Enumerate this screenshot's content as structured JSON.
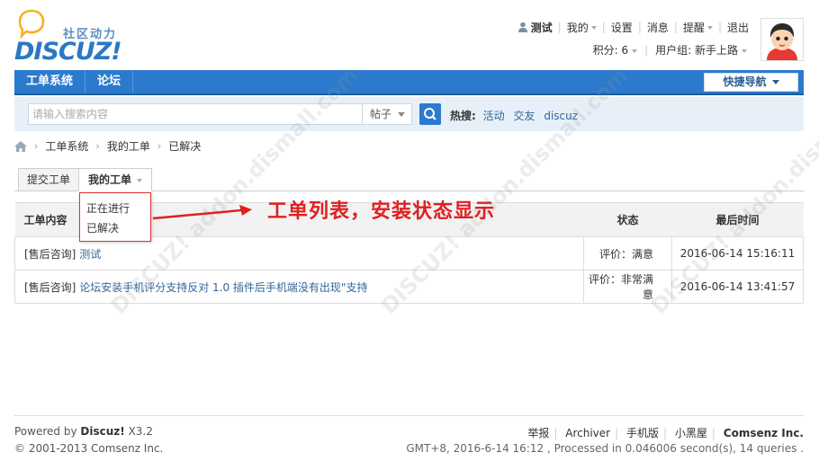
{
  "brand": {
    "cn": "社区动力",
    "en": "DISCUZ!"
  },
  "topnav": {
    "username": "测试",
    "items": [
      "我的",
      "设置",
      "消息",
      "提醒",
      "退出"
    ]
  },
  "userinfo": {
    "points": "积分: 6",
    "group": "用户组: 新手上路"
  },
  "navbar": {
    "items": [
      "工单系统",
      "论坛"
    ],
    "quicknav": "快捷导航"
  },
  "search": {
    "placeholder": "请输入搜索内容",
    "select": "帖子",
    "hot_label": "热搜:",
    "hot_items": [
      "活动",
      "交友",
      "discuz"
    ]
  },
  "breadcrumb": [
    "工单系统",
    "我的工单",
    "已解决"
  ],
  "tabs": [
    "提交工单",
    "我的工单"
  ],
  "dropdown": [
    "正在进行",
    "已解决"
  ],
  "annotation": "工单列表，安装状态显示",
  "table": {
    "headers": [
      "工单内容",
      "状态",
      "最后时间"
    ],
    "rows": [
      {
        "prefix": "[售后咨询]",
        "title": "测试",
        "status": "评价：满意",
        "time": "2016-06-14 15:16:11"
      },
      {
        "prefix": "[售后咨询]",
        "title": "论坛安装手机评分支持反对 1.0 插件后手机端没有出现\"支持",
        "status": "评价：非常满意",
        "time": "2016-06-14 13:41:57"
      }
    ]
  },
  "footer": {
    "powered_prefix": "Powered by",
    "powered_name": "Discuz!",
    "powered_version": "X3.2",
    "copyright": "© 2001-2013 Comsenz Inc.",
    "links": [
      "举报",
      "Archiver",
      "手机版",
      "小黑屋"
    ],
    "company": "Comsenz Inc.",
    "stats": "GMT+8, 2016-6-14 16:12 , Processed in 0.046006 second(s), 14 queries ."
  }
}
